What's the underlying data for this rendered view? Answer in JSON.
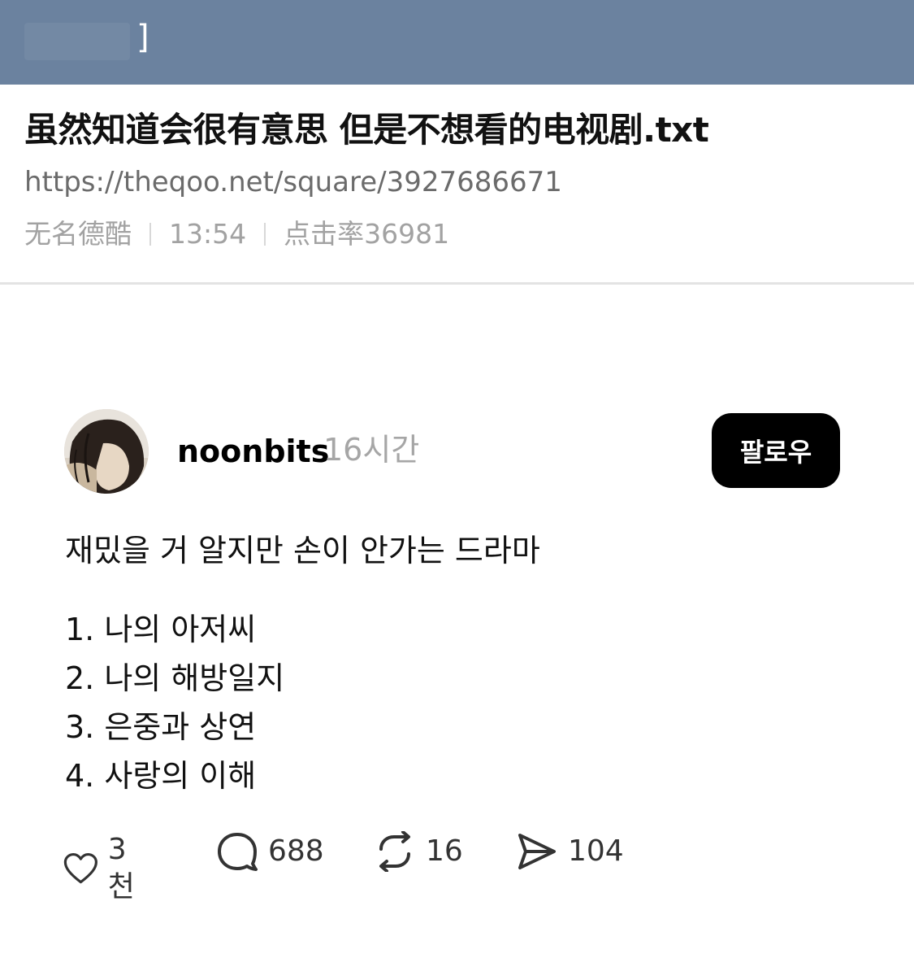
{
  "topbar": {
    "bracket": "]",
    "color": "#6b829f"
  },
  "post": {
    "title": "虽然知道会很有意思 但是不想看的电视剧.txt",
    "url": "https://theqoo.net/square/3927686671",
    "author": "无名德酷",
    "time": "13:54",
    "views": "点击率36981"
  },
  "embed": {
    "username": "noonbits",
    "age": "16시간",
    "follow_label": "팔로우",
    "text": "재밌을 거 알지만 손이 안가는 드라마",
    "list": [
      "1. 나의 아저씨",
      "2. 나의 해방일지",
      "3. 은중과 상연",
      "4. 사랑의 이해"
    ],
    "actions": {
      "likes": "3천",
      "comments": "688",
      "reposts": "16",
      "shares": "104"
    },
    "icons": [
      "heart-icon",
      "comment-icon",
      "repost-icon",
      "share-icon"
    ]
  }
}
